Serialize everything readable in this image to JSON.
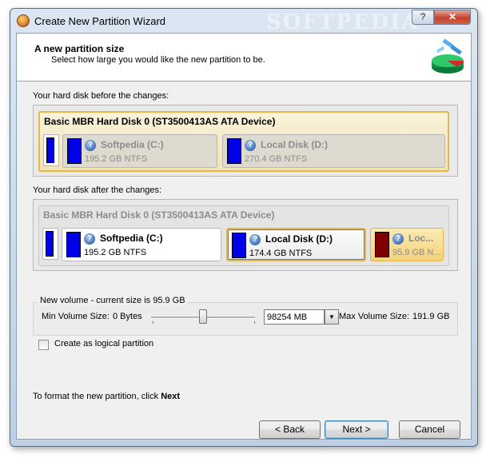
{
  "window": {
    "title": "Create New Partition Wizard",
    "help_label": "?",
    "close_label": "✕",
    "watermark": "SOFTPEDIA"
  },
  "header": {
    "title": "A new partition size",
    "subtitle": "Select how large you would like the new partition to be."
  },
  "before": {
    "label": "Your hard disk before the changes:",
    "disk_title": "Basic MBR Hard Disk 0 (ST3500413AS ATA Device)",
    "partitions": [
      {
        "name": "Softpedia (C:)",
        "size": "195.2 GB NTFS"
      },
      {
        "name": "Local Disk (D:)",
        "size": "270.4 GB NTFS"
      }
    ]
  },
  "after": {
    "label": "Your hard disk after the changes:",
    "disk_title": "Basic MBR Hard Disk 0 (ST3500413AS ATA Device)",
    "partitions": [
      {
        "name": "Softpedia (C:)",
        "size": "195.2 GB NTFS"
      },
      {
        "name": "Local Disk (D:)",
        "size": "174.4 GB NTFS"
      },
      {
        "name": "Loc...",
        "size": "95.9 GB N..."
      }
    ]
  },
  "new_volume": {
    "legend": "New volume - current size is 95.9 GB",
    "min_label": "Min Volume Size:",
    "min_value": "0 Bytes",
    "size_value": "98254 MB",
    "slider_fraction": 0.5,
    "max_label": "Max Volume Size:",
    "max_value": "191.9 GB"
  },
  "options": {
    "logical_label": "Create as logical partition",
    "logical_checked": false
  },
  "footer": {
    "hint_prefix": "To format the new partition, click",
    "hint_next": "Next"
  },
  "buttons": {
    "back": "< Back",
    "next": "Next >",
    "cancel": "Cancel"
  },
  "colors": {
    "partition_blue": "#0000e6",
    "new_partition_red": "#800000",
    "selection_gold": "#e5b84c"
  }
}
